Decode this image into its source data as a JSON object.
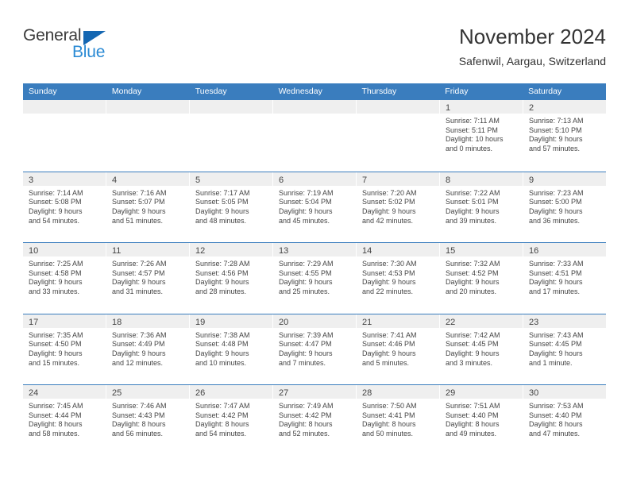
{
  "brand": {
    "name_part1": "General",
    "name_part2": "Blue",
    "triangle_color": "#1567b2",
    "blue_color": "#2a8ad4"
  },
  "header": {
    "title": "November 2024",
    "subtitle": "Safenwil, Aargau, Switzerland"
  },
  "theme": {
    "header_blue": "#3a7dbe",
    "daynum_strip": "#efefef",
    "text": "#444444"
  },
  "calendar": {
    "weekdays": [
      "Sunday",
      "Monday",
      "Tuesday",
      "Wednesday",
      "Thursday",
      "Friday",
      "Saturday"
    ],
    "weeks": [
      [
        {
          "day": "",
          "lines": []
        },
        {
          "day": "",
          "lines": []
        },
        {
          "day": "",
          "lines": []
        },
        {
          "day": "",
          "lines": []
        },
        {
          "day": "",
          "lines": []
        },
        {
          "day": "1",
          "lines": [
            "Sunrise: 7:11 AM",
            "Sunset: 5:11 PM",
            "Daylight: 10 hours",
            "and 0 minutes."
          ]
        },
        {
          "day": "2",
          "lines": [
            "Sunrise: 7:13 AM",
            "Sunset: 5:10 PM",
            "Daylight: 9 hours",
            "and 57 minutes."
          ]
        }
      ],
      [
        {
          "day": "3",
          "lines": [
            "Sunrise: 7:14 AM",
            "Sunset: 5:08 PM",
            "Daylight: 9 hours",
            "and 54 minutes."
          ]
        },
        {
          "day": "4",
          "lines": [
            "Sunrise: 7:16 AM",
            "Sunset: 5:07 PM",
            "Daylight: 9 hours",
            "and 51 minutes."
          ]
        },
        {
          "day": "5",
          "lines": [
            "Sunrise: 7:17 AM",
            "Sunset: 5:05 PM",
            "Daylight: 9 hours",
            "and 48 minutes."
          ]
        },
        {
          "day": "6",
          "lines": [
            "Sunrise: 7:19 AM",
            "Sunset: 5:04 PM",
            "Daylight: 9 hours",
            "and 45 minutes."
          ]
        },
        {
          "day": "7",
          "lines": [
            "Sunrise: 7:20 AM",
            "Sunset: 5:02 PM",
            "Daylight: 9 hours",
            "and 42 minutes."
          ]
        },
        {
          "day": "8",
          "lines": [
            "Sunrise: 7:22 AM",
            "Sunset: 5:01 PM",
            "Daylight: 9 hours",
            "and 39 minutes."
          ]
        },
        {
          "day": "9",
          "lines": [
            "Sunrise: 7:23 AM",
            "Sunset: 5:00 PM",
            "Daylight: 9 hours",
            "and 36 minutes."
          ]
        }
      ],
      [
        {
          "day": "10",
          "lines": [
            "Sunrise: 7:25 AM",
            "Sunset: 4:58 PM",
            "Daylight: 9 hours",
            "and 33 minutes."
          ]
        },
        {
          "day": "11",
          "lines": [
            "Sunrise: 7:26 AM",
            "Sunset: 4:57 PM",
            "Daylight: 9 hours",
            "and 31 minutes."
          ]
        },
        {
          "day": "12",
          "lines": [
            "Sunrise: 7:28 AM",
            "Sunset: 4:56 PM",
            "Daylight: 9 hours",
            "and 28 minutes."
          ]
        },
        {
          "day": "13",
          "lines": [
            "Sunrise: 7:29 AM",
            "Sunset: 4:55 PM",
            "Daylight: 9 hours",
            "and 25 minutes."
          ]
        },
        {
          "day": "14",
          "lines": [
            "Sunrise: 7:30 AM",
            "Sunset: 4:53 PM",
            "Daylight: 9 hours",
            "and 22 minutes."
          ]
        },
        {
          "day": "15",
          "lines": [
            "Sunrise: 7:32 AM",
            "Sunset: 4:52 PM",
            "Daylight: 9 hours",
            "and 20 minutes."
          ]
        },
        {
          "day": "16",
          "lines": [
            "Sunrise: 7:33 AM",
            "Sunset: 4:51 PM",
            "Daylight: 9 hours",
            "and 17 minutes."
          ]
        }
      ],
      [
        {
          "day": "17",
          "lines": [
            "Sunrise: 7:35 AM",
            "Sunset: 4:50 PM",
            "Daylight: 9 hours",
            "and 15 minutes."
          ]
        },
        {
          "day": "18",
          "lines": [
            "Sunrise: 7:36 AM",
            "Sunset: 4:49 PM",
            "Daylight: 9 hours",
            "and 12 minutes."
          ]
        },
        {
          "day": "19",
          "lines": [
            "Sunrise: 7:38 AM",
            "Sunset: 4:48 PM",
            "Daylight: 9 hours",
            "and 10 minutes."
          ]
        },
        {
          "day": "20",
          "lines": [
            "Sunrise: 7:39 AM",
            "Sunset: 4:47 PM",
            "Daylight: 9 hours",
            "and 7 minutes."
          ]
        },
        {
          "day": "21",
          "lines": [
            "Sunrise: 7:41 AM",
            "Sunset: 4:46 PM",
            "Daylight: 9 hours",
            "and 5 minutes."
          ]
        },
        {
          "day": "22",
          "lines": [
            "Sunrise: 7:42 AM",
            "Sunset: 4:45 PM",
            "Daylight: 9 hours",
            "and 3 minutes."
          ]
        },
        {
          "day": "23",
          "lines": [
            "Sunrise: 7:43 AM",
            "Sunset: 4:45 PM",
            "Daylight: 9 hours",
            "and 1 minute."
          ]
        }
      ],
      [
        {
          "day": "24",
          "lines": [
            "Sunrise: 7:45 AM",
            "Sunset: 4:44 PM",
            "Daylight: 8 hours",
            "and 58 minutes."
          ]
        },
        {
          "day": "25",
          "lines": [
            "Sunrise: 7:46 AM",
            "Sunset: 4:43 PM",
            "Daylight: 8 hours",
            "and 56 minutes."
          ]
        },
        {
          "day": "26",
          "lines": [
            "Sunrise: 7:47 AM",
            "Sunset: 4:42 PM",
            "Daylight: 8 hours",
            "and 54 minutes."
          ]
        },
        {
          "day": "27",
          "lines": [
            "Sunrise: 7:49 AM",
            "Sunset: 4:42 PM",
            "Daylight: 8 hours",
            "and 52 minutes."
          ]
        },
        {
          "day": "28",
          "lines": [
            "Sunrise: 7:50 AM",
            "Sunset: 4:41 PM",
            "Daylight: 8 hours",
            "and 50 minutes."
          ]
        },
        {
          "day": "29",
          "lines": [
            "Sunrise: 7:51 AM",
            "Sunset: 4:40 PM",
            "Daylight: 8 hours",
            "and 49 minutes."
          ]
        },
        {
          "day": "30",
          "lines": [
            "Sunrise: 7:53 AM",
            "Sunset: 4:40 PM",
            "Daylight: 8 hours",
            "and 47 minutes."
          ]
        }
      ]
    ]
  }
}
